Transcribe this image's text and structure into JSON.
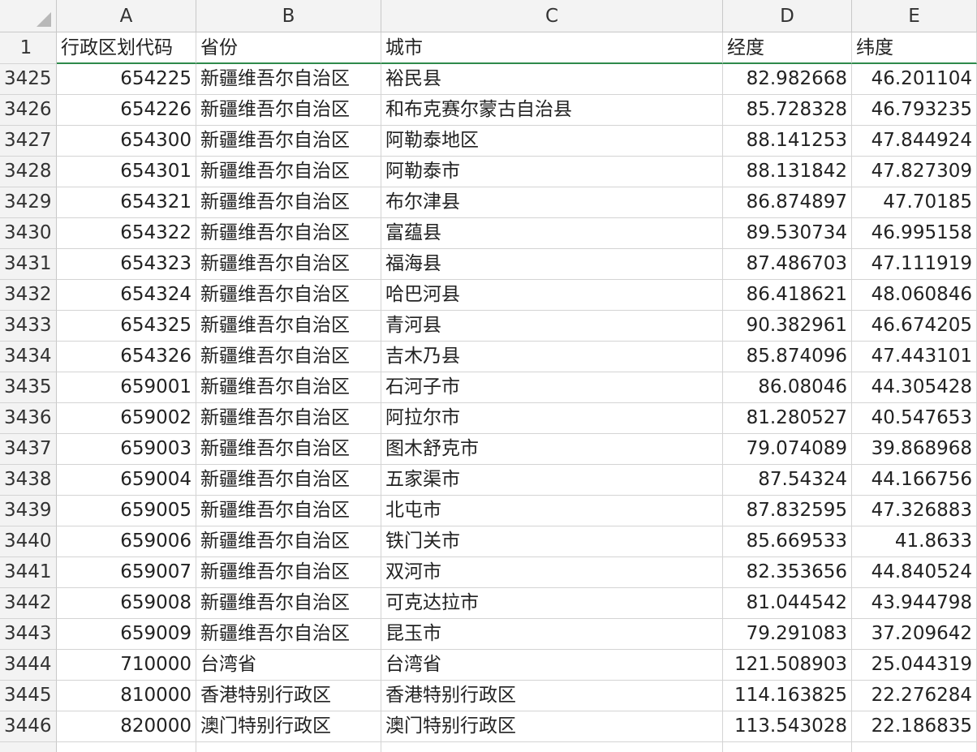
{
  "columns": [
    "A",
    "B",
    "C",
    "D",
    "E"
  ],
  "header_row": {
    "row_number": "1",
    "cells": [
      "行政区划代码",
      "省份",
      "城市",
      "经度",
      "纬度"
    ]
  },
  "rows": [
    {
      "n": "3425",
      "code": "654225",
      "province": "新疆维吾尔自治区",
      "city": "裕民县",
      "lng": "82.982668",
      "lat": "46.201104"
    },
    {
      "n": "3426",
      "code": "654226",
      "province": "新疆维吾尔自治区",
      "city": "和布克赛尔蒙古自治县",
      "lng": "85.728328",
      "lat": "46.793235"
    },
    {
      "n": "3427",
      "code": "654300",
      "province": "新疆维吾尔自治区",
      "city": "阿勒泰地区",
      "lng": "88.141253",
      "lat": "47.844924"
    },
    {
      "n": "3428",
      "code": "654301",
      "province": "新疆维吾尔自治区",
      "city": "阿勒泰市",
      "lng": "88.131842",
      "lat": "47.827309"
    },
    {
      "n": "3429",
      "code": "654321",
      "province": "新疆维吾尔自治区",
      "city": "布尔津县",
      "lng": "86.874897",
      "lat": "47.70185"
    },
    {
      "n": "3430",
      "code": "654322",
      "province": "新疆维吾尔自治区",
      "city": "富蕴县",
      "lng": "89.530734",
      "lat": "46.995158"
    },
    {
      "n": "3431",
      "code": "654323",
      "province": "新疆维吾尔自治区",
      "city": "福海县",
      "lng": "87.486703",
      "lat": "47.111919"
    },
    {
      "n": "3432",
      "code": "654324",
      "province": "新疆维吾尔自治区",
      "city": "哈巴河县",
      "lng": "86.418621",
      "lat": "48.060846"
    },
    {
      "n": "3433",
      "code": "654325",
      "province": "新疆维吾尔自治区",
      "city": "青河县",
      "lng": "90.382961",
      "lat": "46.674205"
    },
    {
      "n": "3434",
      "code": "654326",
      "province": "新疆维吾尔自治区",
      "city": "吉木乃县",
      "lng": "85.874096",
      "lat": "47.443101"
    },
    {
      "n": "3435",
      "code": "659001",
      "province": "新疆维吾尔自治区",
      "city": "石河子市",
      "lng": "86.08046",
      "lat": "44.305428"
    },
    {
      "n": "3436",
      "code": "659002",
      "province": "新疆维吾尔自治区",
      "city": "阿拉尔市",
      "lng": "81.280527",
      "lat": "40.547653"
    },
    {
      "n": "3437",
      "code": "659003",
      "province": "新疆维吾尔自治区",
      "city": "图木舒克市",
      "lng": "79.074089",
      "lat": "39.868968"
    },
    {
      "n": "3438",
      "code": "659004",
      "province": "新疆维吾尔自治区",
      "city": "五家渠市",
      "lng": "87.54324",
      "lat": "44.166756"
    },
    {
      "n": "3439",
      "code": "659005",
      "province": "新疆维吾尔自治区",
      "city": "北屯市",
      "lng": "87.832595",
      "lat": "47.326883"
    },
    {
      "n": "3440",
      "code": "659006",
      "province": "新疆维吾尔自治区",
      "city": "铁门关市",
      "lng": "85.669533",
      "lat": "41.8633"
    },
    {
      "n": "3441",
      "code": "659007",
      "province": "新疆维吾尔自治区",
      "city": "双河市",
      "lng": "82.353656",
      "lat": "44.840524"
    },
    {
      "n": "3442",
      "code": "659008",
      "province": "新疆维吾尔自治区",
      "city": "可克达拉市",
      "lng": "81.044542",
      "lat": "43.944798"
    },
    {
      "n": "3443",
      "code": "659009",
      "province": "新疆维吾尔自治区",
      "city": "昆玉市",
      "lng": "79.291083",
      "lat": "37.209642"
    },
    {
      "n": "3444",
      "code": "710000",
      "province": "台湾省",
      "city": "台湾省",
      "lng": "121.508903",
      "lat": "25.044319"
    },
    {
      "n": "3445",
      "code": "810000",
      "province": "香港特别行政区",
      "city": "香港特别行政区",
      "lng": "114.163825",
      "lat": "22.276284"
    },
    {
      "n": "3446",
      "code": "820000",
      "province": "澳门特别行政区",
      "city": "澳门特别行政区",
      "lng": "113.543028",
      "lat": "22.186835"
    }
  ],
  "colors": {
    "header_bg": "#f3f3f3",
    "grid_line": "#d4d4d4",
    "selection_green": "#2f8a4b"
  }
}
